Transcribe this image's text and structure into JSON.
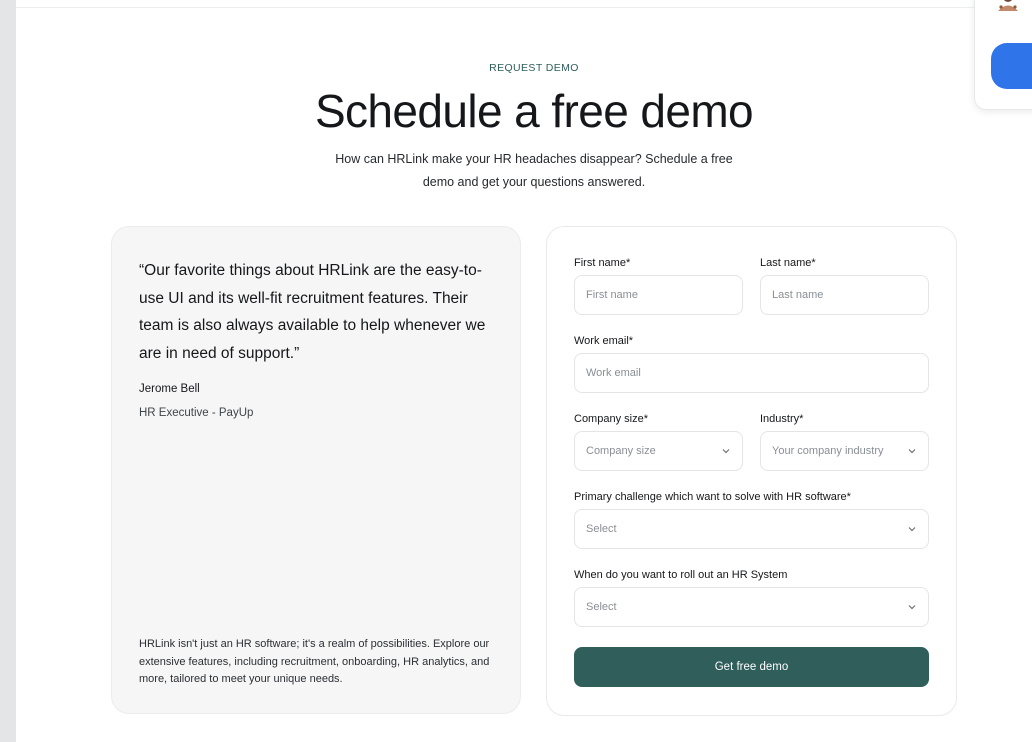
{
  "header": {
    "eyebrow": "REQUEST DEMO",
    "title": "Schedule a free demo",
    "subtitle": "How can HRLink make your HR headaches disappear? Schedule a free demo and get your questions answered."
  },
  "testimonial": {
    "quote": "“Our favorite things about HRLink are the easy-to-use UI and its well-fit recruitment features. Their team is also always available to help whenever we are in need of support.”",
    "author_name": "Jerome Bell",
    "author_role": "HR Executive - PayUp",
    "footer": "HRLink isn't just an HR software; it's a realm of possibilities. Explore our extensive features, including recruitment, onboarding, HR analytics, and more, tailored to meet your unique needs."
  },
  "form": {
    "first_name": {
      "label": "First name*",
      "placeholder": "First name",
      "value": ""
    },
    "last_name": {
      "label": "Last name*",
      "placeholder": "Last name",
      "value": ""
    },
    "work_email": {
      "label": "Work email*",
      "placeholder": "Work email",
      "value": ""
    },
    "company_size": {
      "label": "Company size*",
      "selected": "Company size"
    },
    "industry": {
      "label": "Industry*",
      "selected": "Your company industry"
    },
    "primary_challenge": {
      "label": "Primary challenge which want to solve with HR software*",
      "selected": "Select"
    },
    "rollout_time": {
      "label": "When do you want to roll out an HR System",
      "selected": "Select"
    },
    "submit_label": "Get free demo"
  },
  "colors": {
    "accent": "#2f5e5b",
    "eyebrow": "#2d5f5c",
    "floating_button": "#2f74e8"
  },
  "icons": {
    "dropdown": "chevron-down-icon"
  }
}
